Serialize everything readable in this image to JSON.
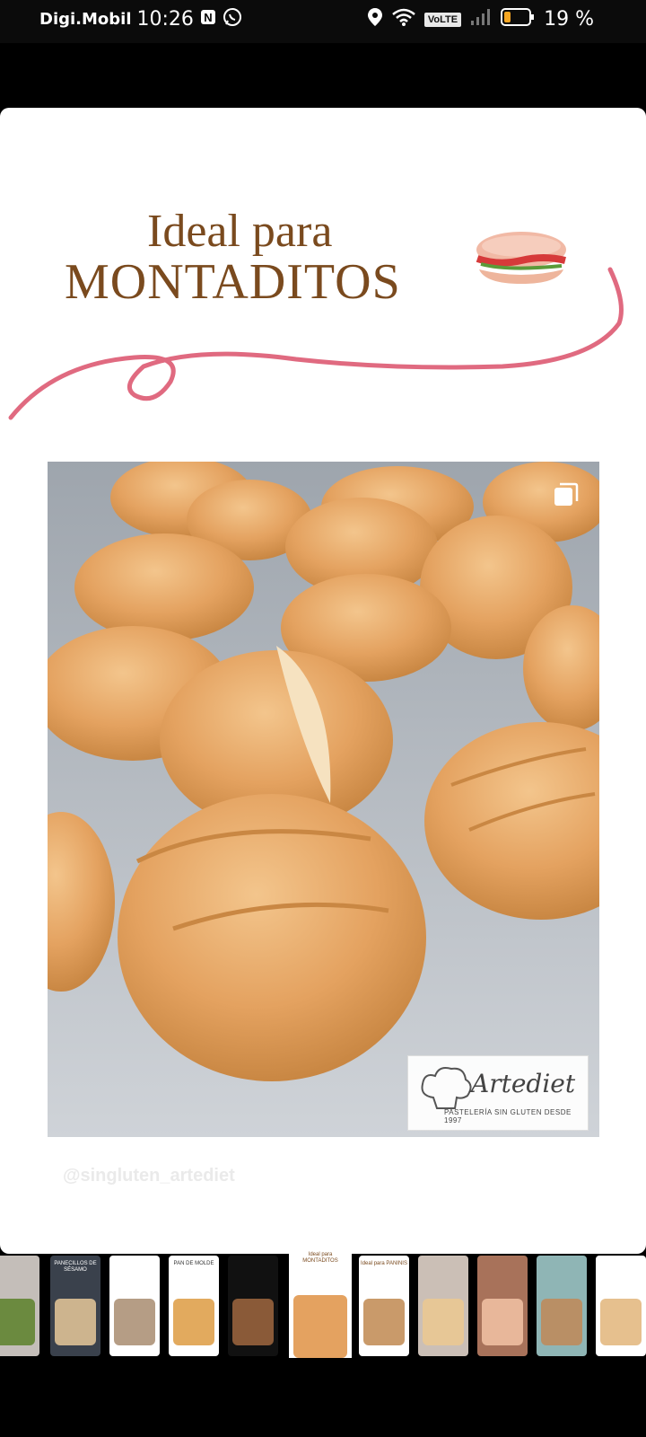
{
  "status_bar": {
    "carrier": "Digi.Mobil",
    "time": "10:26",
    "network_badge": "VoLTE",
    "battery": "19 %"
  },
  "story": {
    "title_line1": "Ideal para",
    "title_line2": "MONTADITOS",
    "title_color": "#7a4a1e",
    "swirl_color": "#e06a80",
    "watermark_handle": "@singluten_artediet",
    "logo": {
      "name": "Artediet",
      "tagline": "PASTELERÍA SIN GLUTEN DESDE 1997"
    }
  },
  "thumbnails": [
    {
      "caption": "",
      "active": false
    },
    {
      "caption": "PANECILLOS DE SÉSAMO",
      "active": false
    },
    {
      "caption": "",
      "active": false
    },
    {
      "caption": "PAN DE MOLDE",
      "active": false
    },
    {
      "caption": "",
      "active": false
    },
    {
      "caption": "Ideal para MONTADITOS",
      "active": true
    },
    {
      "caption": "Ideal para PANINIS",
      "active": false
    },
    {
      "caption": "",
      "active": false
    },
    {
      "caption": "",
      "active": false
    },
    {
      "caption": "",
      "active": false
    },
    {
      "caption": "",
      "active": false
    }
  ]
}
